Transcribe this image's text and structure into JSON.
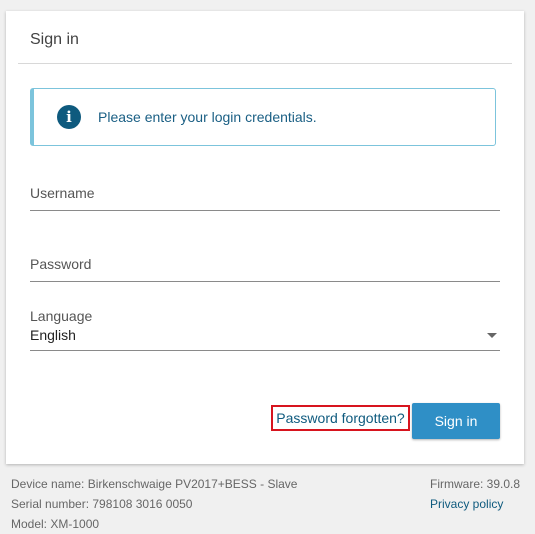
{
  "card": {
    "title": "Sign in",
    "alert": {
      "icon": "info-icon",
      "text": "Please enter your login credentials."
    },
    "username": {
      "label": "Username",
      "value": ""
    },
    "password": {
      "label": "Password",
      "value": ""
    },
    "language": {
      "label": "Language",
      "value": "English"
    },
    "forgot_link": "Password forgotten?",
    "signin_button": "Sign in"
  },
  "footer": {
    "device_name": "Device name: Birkenschwaige PV2017+BESS - Slave",
    "serial_number": "Serial number: 798108 3016 0050",
    "model": "Model: XM-1000",
    "firmware": "Firmware: 39.0.8",
    "privacy_link": "Privacy policy"
  },
  "colors": {
    "accent": "#2f8fc6",
    "link": "#0e5a7e",
    "alert_border": "#7cc4dc",
    "highlight_border": "#d7141e"
  }
}
